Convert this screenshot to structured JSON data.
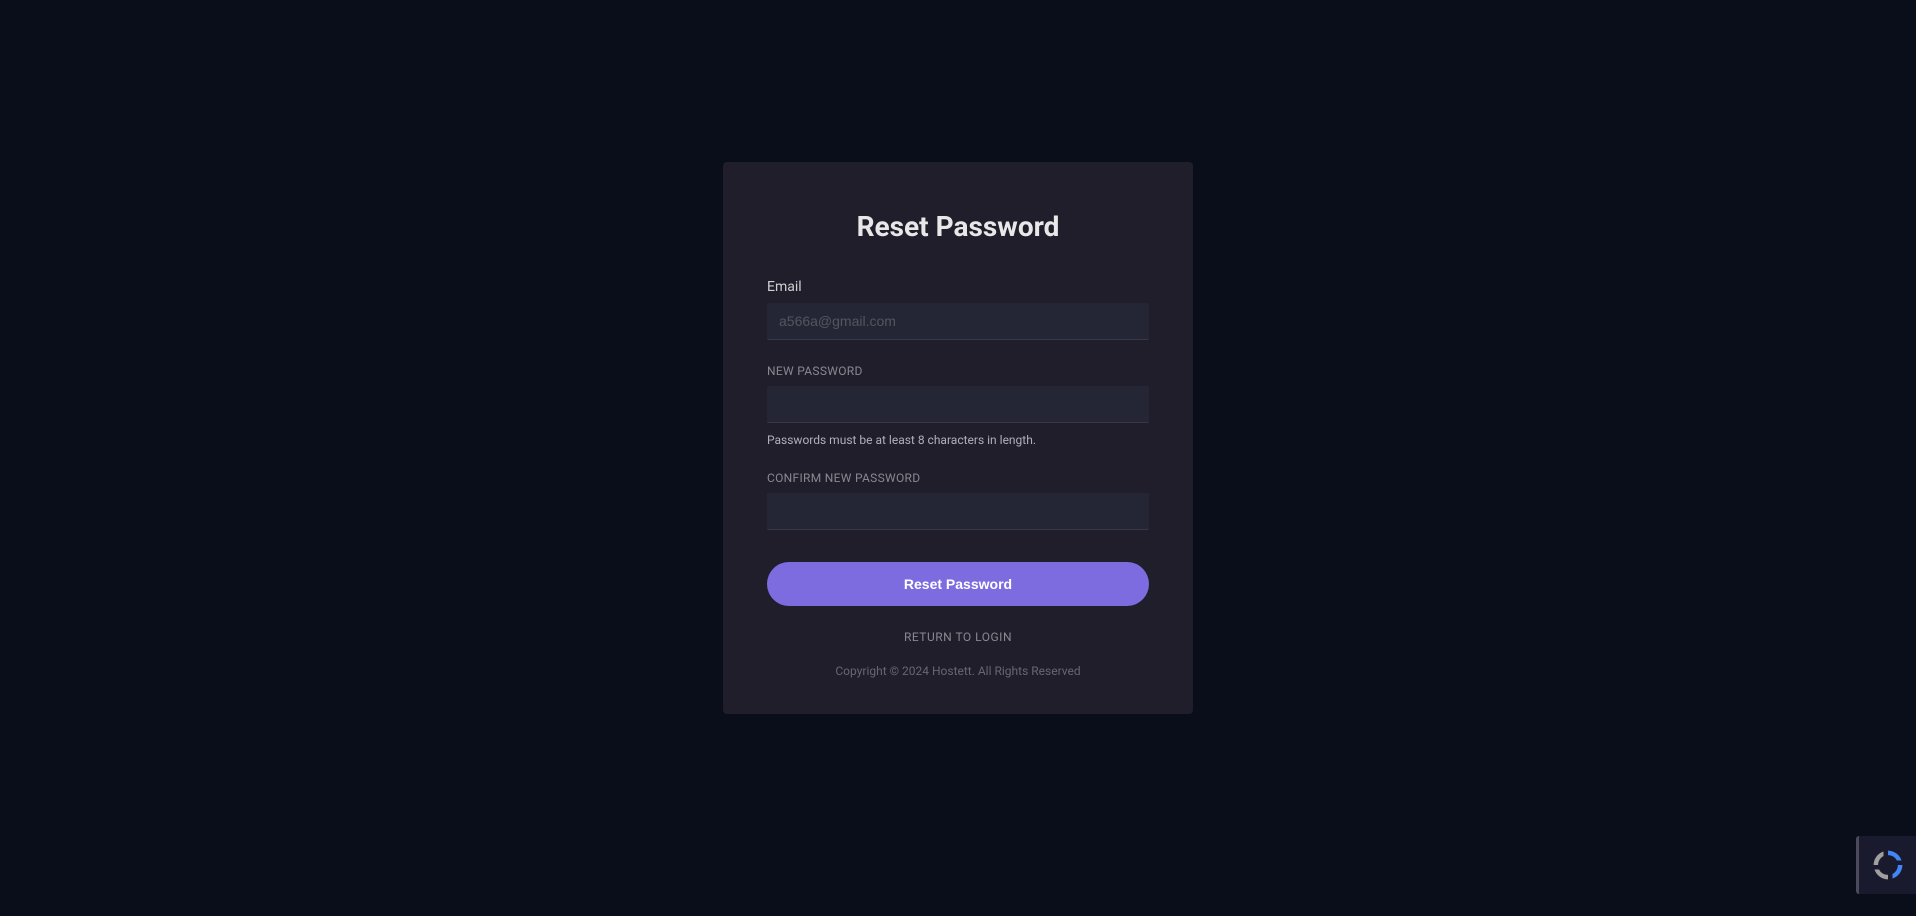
{
  "title": "Reset Password",
  "form": {
    "email": {
      "label": "Email",
      "placeholder": "a566a@gmail.com",
      "value": ""
    },
    "newPassword": {
      "label": "NEW PASSWORD",
      "helpText": "Passwords must be at least 8 characters in length."
    },
    "confirmPassword": {
      "label": "CONFIRM NEW PASSWORD"
    },
    "submitLabel": "Reset Password"
  },
  "returnLink": "RETURN TO LOGIN",
  "copyright": "Copyright © 2024 Hostett. All Rights Reserved"
}
